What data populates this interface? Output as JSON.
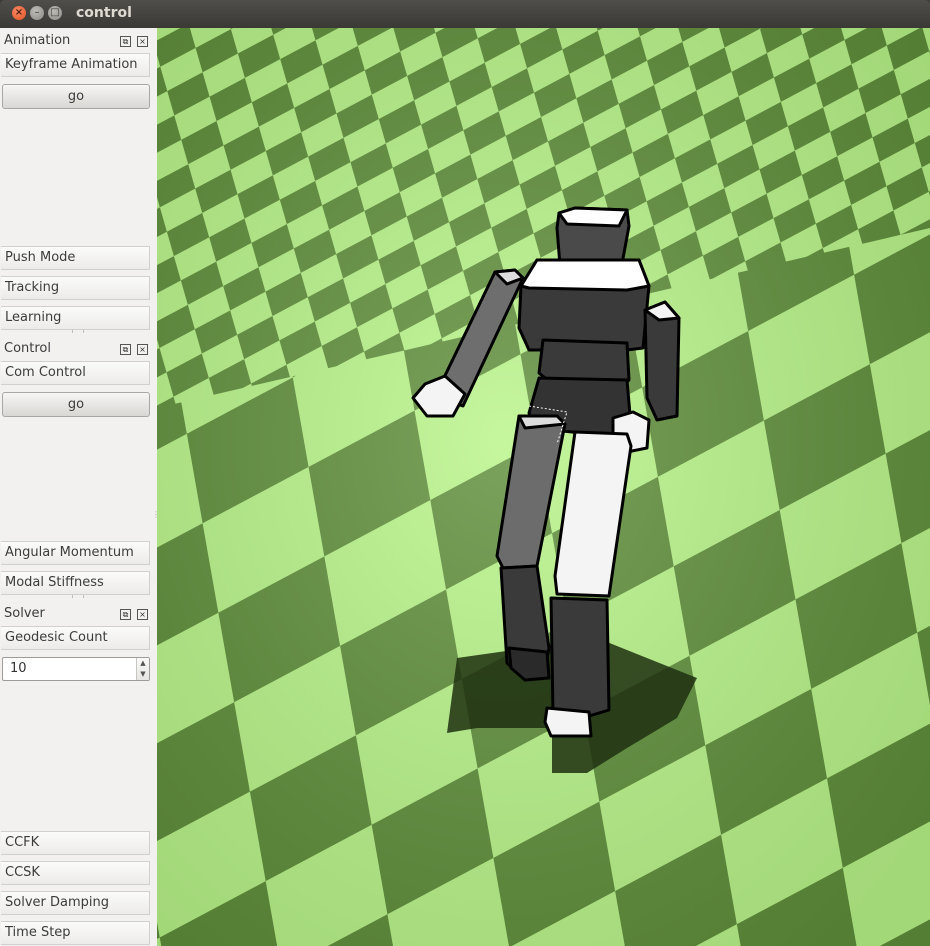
{
  "window": {
    "title": "control"
  },
  "docks": {
    "animation": {
      "title": "Animation",
      "keyframe_label": "Keyframe Animation",
      "go_label": "go",
      "push_label": "Push Mode",
      "tracking_label": "Tracking",
      "learning_label": "Learning"
    },
    "control": {
      "title": "Control",
      "com_label": "Com Control",
      "go_label": "go",
      "angular_label": "Angular Momentum",
      "modal_label": "Modal Stiffness"
    },
    "solver": {
      "title": "Solver",
      "geodesic_label": "Geodesic Count",
      "geodesic_value": "10",
      "ccfk_label": "CCFK",
      "ccsk_label": "CCSK",
      "damping_label": "Solver Damping",
      "timestep_label": "Time Step"
    }
  },
  "colors": {
    "floor_light": "#b9f589",
    "floor_dark": "#5f8f3a",
    "panel_bg": "#f2f1f0",
    "titlebar": "#3c3b37"
  },
  "icons": {
    "close": "close-icon",
    "minimize": "minimize-icon",
    "maximize": "maximize-icon",
    "float": "float-icon",
    "dock_close": "dock-close-icon"
  }
}
